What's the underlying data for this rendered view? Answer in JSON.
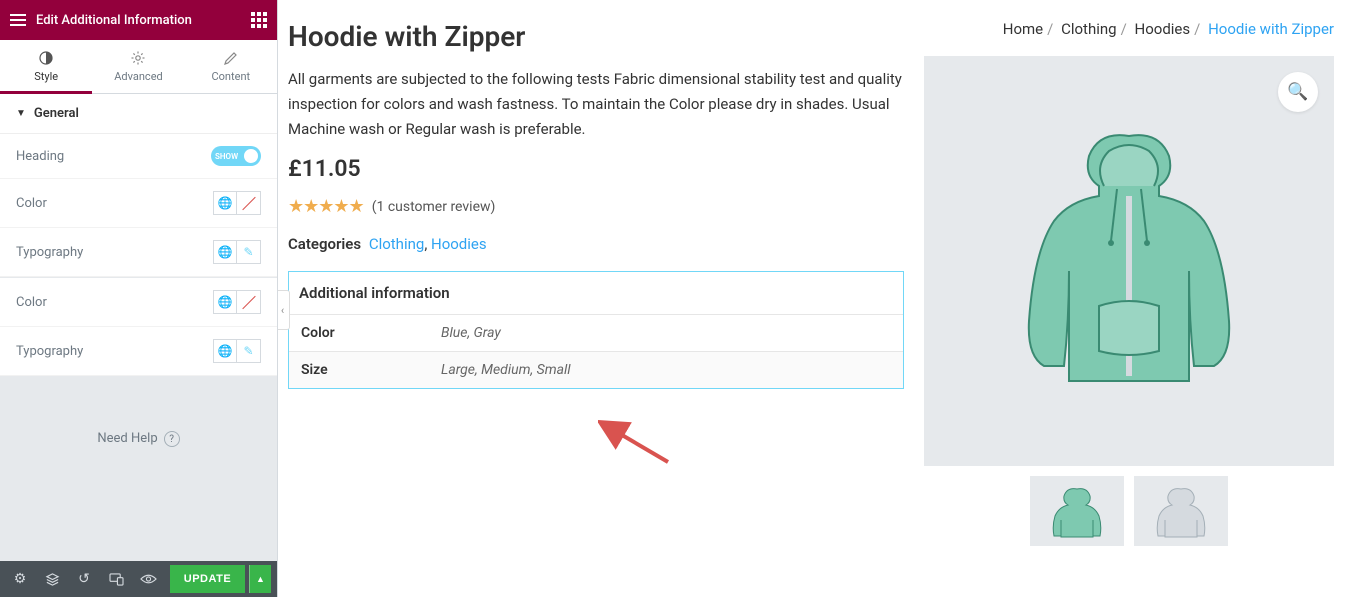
{
  "sidebar": {
    "title": "Edit Additional Information",
    "tabs": [
      {
        "id": "style",
        "label": "Style",
        "active": true
      },
      {
        "id": "advanced",
        "label": "Advanced",
        "active": false
      },
      {
        "id": "content",
        "label": "Content",
        "active": false
      }
    ],
    "section_title": "General",
    "rows": [
      {
        "label": "Heading",
        "control": "toggle",
        "toggle_text": "SHOW"
      },
      {
        "label": "Color",
        "control": "color"
      },
      {
        "label": "Typography",
        "control": "typo"
      },
      {
        "label": "Color",
        "control": "color"
      },
      {
        "label": "Typography",
        "control": "typo"
      }
    ],
    "help_text": "Need Help",
    "update_label": "UPDATE"
  },
  "product": {
    "title": "Hoodie with Zipper",
    "description": "All garments are subjected to the following tests Fabric dimensional stability test and quality inspection for colors and wash fastness. To maintain the Color please dry in shades. Usual Machine wash or Regular wash is preferable.",
    "price": "£11.05",
    "review_text": "(1 customer review)",
    "categories_label": "Categories",
    "categories": [
      {
        "name": "Clothing"
      },
      {
        "name": "Hoodies"
      }
    ],
    "additional_heading": "Additional information",
    "attributes": [
      {
        "name": "Color",
        "value": "Blue, Gray"
      },
      {
        "name": "Size",
        "value": "Large, Medium, Small"
      }
    ]
  },
  "breadcrumb": {
    "items": [
      {
        "label": "Home"
      },
      {
        "label": "Clothing"
      },
      {
        "label": "Hoodies"
      }
    ],
    "current": "Hoodie with Zipper"
  }
}
